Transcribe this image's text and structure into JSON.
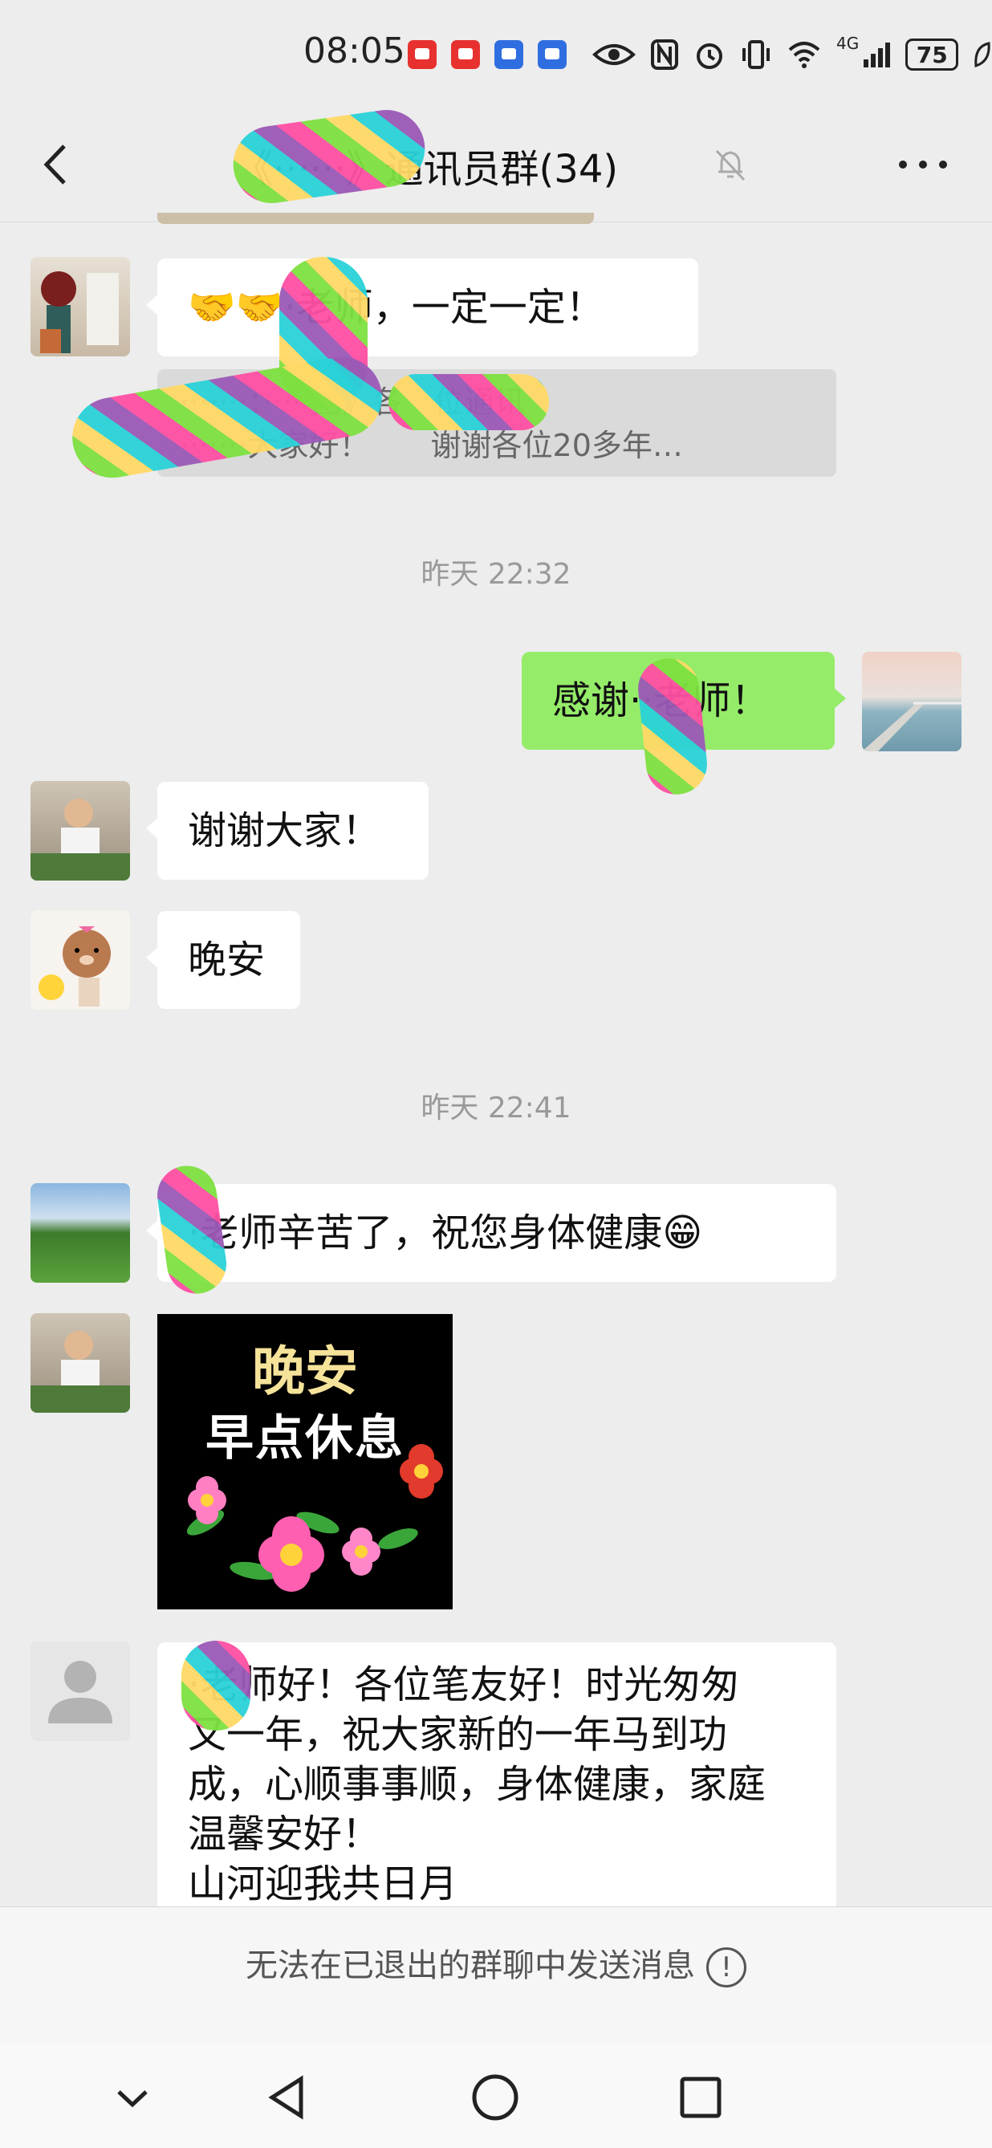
{
  "status_bar": {
    "time": "08:05",
    "network": "4G",
    "battery": "75",
    "app_icon_colors": [
      "#e7312f",
      "#e7312f",
      "#2f6ee0",
      "#2f6ee0"
    ],
    "icons": [
      "eye-icon",
      "nfc-icon",
      "alarm-icon",
      "vibrate-icon",
      "wifi-icon",
      "signal-icon",
      "battery-icon",
      "leaf-icon"
    ]
  },
  "header": {
    "title": "《······》通讯员群(34)",
    "back_icon": "chevron-left-icon",
    "mute_icon": "bell-off-icon",
    "more_icon": "more-horizontal-icon"
  },
  "messages": [
    {
      "type": "text",
      "side": "in",
      "avatar": "vase-photo",
      "text": "🤝🤝·老师，一定一定！"
    },
    {
      "type": "quote",
      "line1": "·······：·····团》各　位通讯",
      "line2": "·······大家好！　　谢谢各位20多年…"
    },
    {
      "type": "timestamp",
      "text": "昨天 22:32"
    },
    {
      "type": "text",
      "side": "out",
      "avatar": "pier-photo",
      "text": "感谢··老师！"
    },
    {
      "type": "text",
      "side": "in",
      "avatar": "man-photo",
      "text": "谢谢大家！"
    },
    {
      "type": "text",
      "side": "in",
      "avatar": "bear-cartoon",
      "text": "晚安"
    },
    {
      "type": "timestamp",
      "text": "昨天 22:41"
    },
    {
      "type": "text",
      "side": "in",
      "avatar": "meadow-photo",
      "text": "·老师辛苦了，祝您身体健康😁"
    },
    {
      "type": "image",
      "side": "in",
      "avatar": "man-photo",
      "image_line1": "晚安",
      "image_line2": "早点休息"
    },
    {
      "type": "text",
      "side": "in",
      "avatar": "default-avatar",
      "lines": [
        "·老师好！各位笔友好！时光匆匆",
        "又一年，祝大家新的一年马到功",
        "成，心顺事事顺，身体健康，家庭",
        "温馨安好！",
        "山河迎我共日月"
      ]
    }
  ],
  "footer": {
    "notice": "无法在已退出的群聊中发送消息",
    "notice_icon": "alert-circle-icon"
  },
  "nav": {
    "buttons": [
      "collapse-icon",
      "back-triangle-icon",
      "home-circle-icon",
      "recents-square-icon"
    ]
  }
}
